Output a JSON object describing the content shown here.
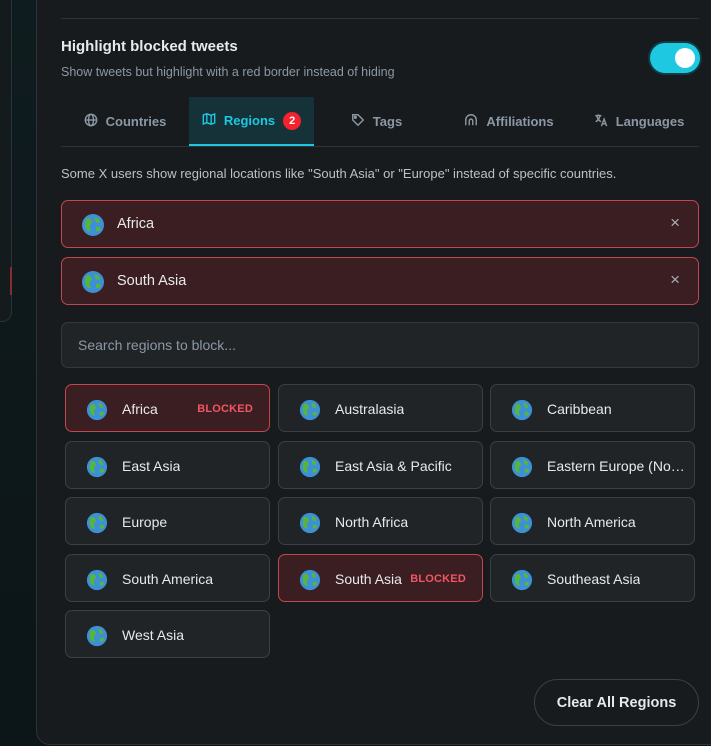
{
  "setting": {
    "title": "Highlight blocked tweets",
    "description": "Show tweets but highlight with a red border instead of hiding",
    "toggle_on": true
  },
  "tabs": [
    {
      "label": "Countries",
      "icon": "globe-icon"
    },
    {
      "label": "Regions",
      "icon": "map-icon",
      "badge": "2",
      "active": true
    },
    {
      "label": "Tags",
      "icon": "tag-icon"
    },
    {
      "label": "Affiliations",
      "icon": "affiliation-icon"
    },
    {
      "label": "Languages",
      "icon": "translate-icon"
    }
  ],
  "help_text": "Some X users show regional locations like \"South Asia\" or \"Europe\" instead of specific countries.",
  "blocked_regions": [
    {
      "name": "Africa",
      "remove": "×"
    },
    {
      "name": "South Asia",
      "remove": "×"
    }
  ],
  "search": {
    "placeholder": "Search regions to block..."
  },
  "blocked_tag": "BLOCKED",
  "regions": [
    {
      "name": "Africa",
      "blocked": true
    },
    {
      "name": "Australasia"
    },
    {
      "name": "Caribbean"
    },
    {
      "name": "East Asia"
    },
    {
      "name": "East Asia & Pacific"
    },
    {
      "name": "Eastern Europe (Non-EU)"
    },
    {
      "name": "Europe"
    },
    {
      "name": "North Africa"
    },
    {
      "name": "North America"
    },
    {
      "name": "South America"
    },
    {
      "name": "South Asia",
      "blocked": true
    },
    {
      "name": "Southeast Asia"
    },
    {
      "name": "West Asia"
    }
  ],
  "clear_button": "Clear All Regions",
  "colors": {
    "accent": "#1ec8e0",
    "blocked_border": "#c0474f",
    "blocked_bg": "#3a1e22",
    "badge": "#f4212e"
  }
}
